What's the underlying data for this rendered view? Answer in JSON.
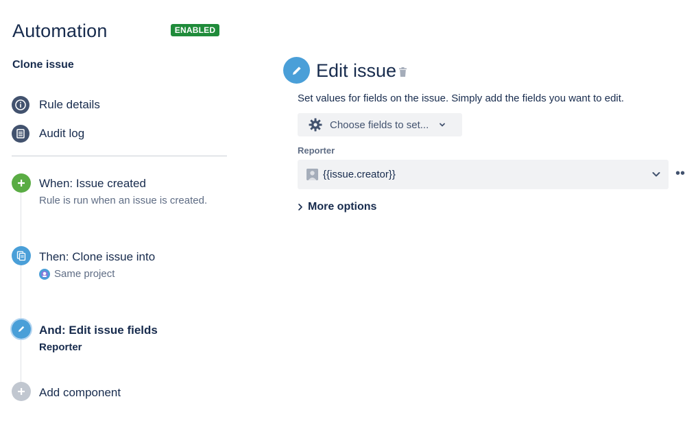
{
  "header": {
    "title": "Automation",
    "status": "ENABLED",
    "status_color": "#1f8b3a"
  },
  "rule": {
    "name": "Clone issue"
  },
  "nav": [
    {
      "label": "Rule details",
      "icon": "info-icon"
    },
    {
      "label": "Audit log",
      "icon": "audit-log-icon"
    }
  ],
  "timeline": {
    "trigger": {
      "title": "When: Issue created",
      "subtitle": "Rule is run when an issue is created.",
      "icon": "plus-icon",
      "color": "#5aac44"
    },
    "action1": {
      "title": "Then: Clone issue into",
      "subtitle": "Same project",
      "icon": "clone-icon",
      "color": "#4a9fd8"
    },
    "action2": {
      "title": "And: Edit issue fields",
      "subtitle": "Reporter",
      "icon": "pencil-icon",
      "color": "#4a9fd8"
    },
    "add": {
      "title": "Add component",
      "icon": "plus-icon",
      "color": "#c1c7d0"
    }
  },
  "panel": {
    "title": "Edit issue",
    "description": "Set values for fields on the issue. Simply add the fields you want to edit.",
    "choose_fields_label": "Choose fields to set...",
    "field_label": "Reporter",
    "reporter_value": "{{issue.creator}}",
    "more_options_label": "More options",
    "ellipsis": "••"
  }
}
